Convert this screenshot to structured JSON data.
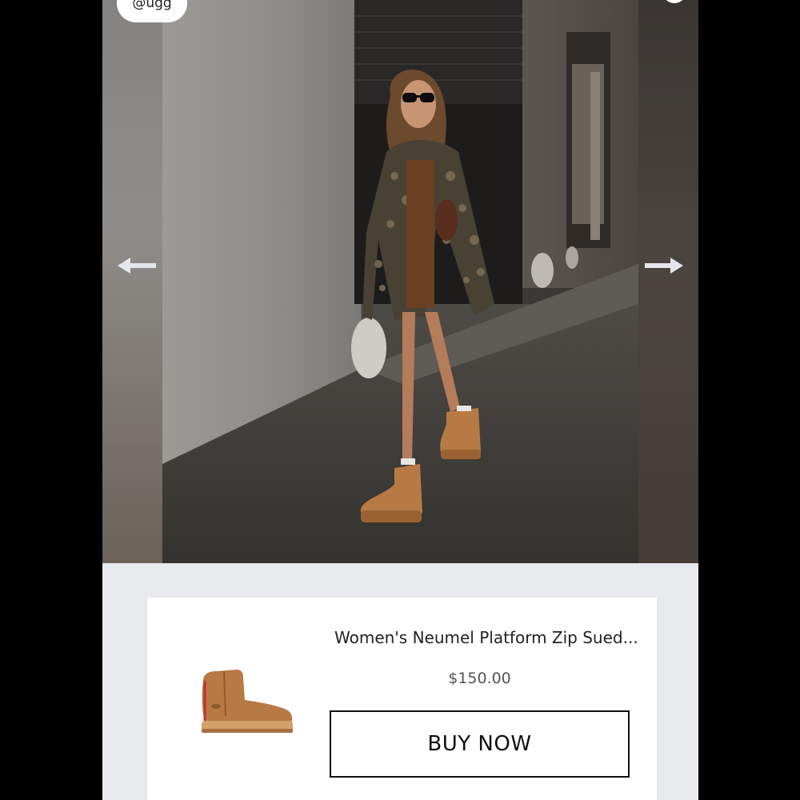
{
  "modal": {
    "handle": "@ugg",
    "gallery": {
      "prev_icon": "arrow-left-icon",
      "next_icon": "arrow-right-icon",
      "photo_alt": "Woman walking in alley wearing UGG platform boots"
    }
  },
  "product": {
    "title": "Women's Neumel Platform Zip Sued...",
    "price": "$150.00",
    "buy_label": "BUY NOW",
    "thumb_icon": "boot-product-image"
  },
  "colors": {
    "backdrop": "#000000",
    "panel": "#e9eaee",
    "card": "#ffffff",
    "boot": "#b77a44"
  }
}
